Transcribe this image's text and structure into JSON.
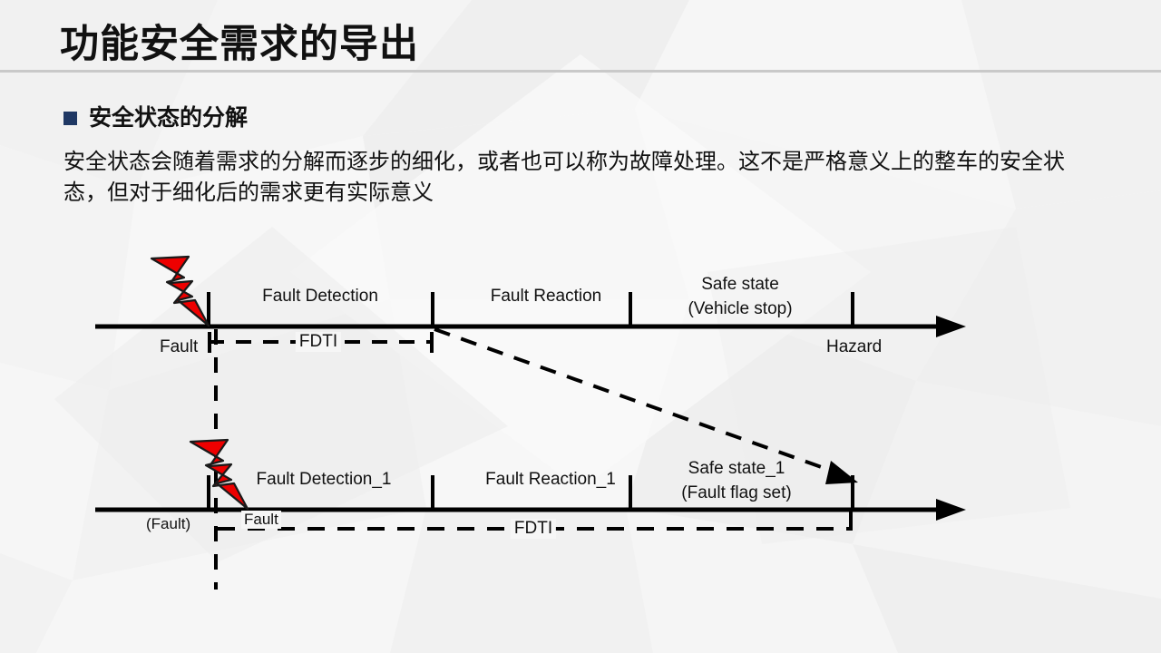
{
  "slide": {
    "title": "功能安全需求的导出",
    "bullet_heading": "安全状态的分解",
    "body_text": "安全状态会随着需求的分解而逐步的细化，或者也可以称为故障处理。这不是严格意义上的整车的安全状态，但对于细化后的需求更有实际意义",
    "colors": {
      "background": "#f5f5f5",
      "title_text": "#111111",
      "divider": "#c9c9c9",
      "bullet": "#1f3864",
      "lightning": "#ee0000",
      "axis": "#000000"
    }
  },
  "diagram": {
    "top_timeline": {
      "phases": [
        {
          "label": "Fault Detection"
        },
        {
          "label": "Fault Reaction"
        },
        {
          "label": "Safe state",
          "label2": "(Vehicle stop)"
        }
      ],
      "event_labels": [
        {
          "label": "Fault"
        },
        {
          "label": "Hazard"
        }
      ],
      "interval_label": "FDTI"
    },
    "bottom_timeline": {
      "phases": [
        {
          "label": "Fault Detection_1"
        },
        {
          "label": "Fault Reaction_1"
        },
        {
          "label": "Safe state_1",
          "label2": "(Fault flag set)"
        }
      ],
      "event_labels": [
        {
          "label": "(Fault)"
        },
        {
          "label": "Fault"
        }
      ],
      "interval_label": "FDTI"
    }
  }
}
